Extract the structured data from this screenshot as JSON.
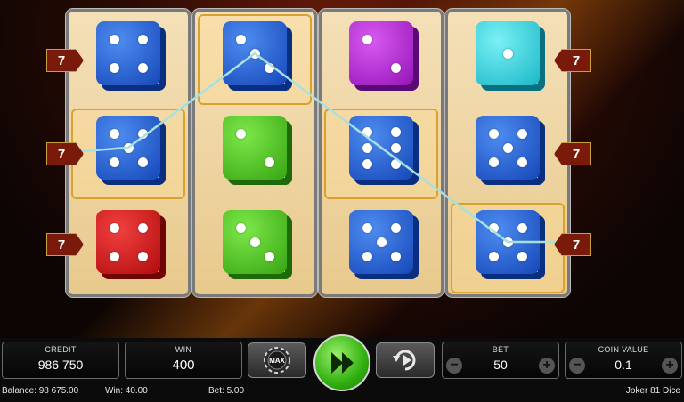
{
  "game": {
    "title": "Joker 81 Dice",
    "top_label": "..."
  },
  "reels": [
    [
      {
        "color": "blue",
        "value": 4,
        "win": false
      },
      {
        "color": "blue",
        "value": 5,
        "win": true
      },
      {
        "color": "red",
        "value": 4,
        "win": false
      }
    ],
    [
      {
        "color": "blue",
        "value": 3,
        "win": true
      },
      {
        "color": "green",
        "value": 2,
        "win": false
      },
      {
        "color": "green",
        "value": 3,
        "win": false
      }
    ],
    [
      {
        "color": "purple",
        "value": 2,
        "win": false
      },
      {
        "color": "blue",
        "value": 6,
        "win": true
      },
      {
        "color": "blue",
        "value": 5,
        "win": false
      }
    ],
    [
      {
        "color": "cyan",
        "value": 1,
        "win": false
      },
      {
        "color": "blue",
        "value": 5,
        "win": false
      },
      {
        "color": "blue",
        "value": 5,
        "win": true
      }
    ]
  ],
  "line_markers": {
    "left": [
      "7",
      "7",
      "7"
    ],
    "right": [
      "7",
      "7",
      "7"
    ]
  },
  "controls": {
    "credit_label": "CREDIT",
    "credit_value": "986 750",
    "win_label": "WIN",
    "win_value": "400",
    "max_label": "MAX",
    "bet_label": "BET",
    "bet_value": "50",
    "coin_label": "COIN VALUE",
    "coin_value": "0.1",
    "minus": "−",
    "plus": "+"
  },
  "status": {
    "balance": "Balance: 98 675.00",
    "win": "Win: 40.00",
    "bet": "Bet: 5.00",
    "game_name": "Joker 81 Dice"
  },
  "colors": {
    "payline": "#a8e0e0",
    "win_border": "#d9a230",
    "spin_button": "#32b010"
  }
}
